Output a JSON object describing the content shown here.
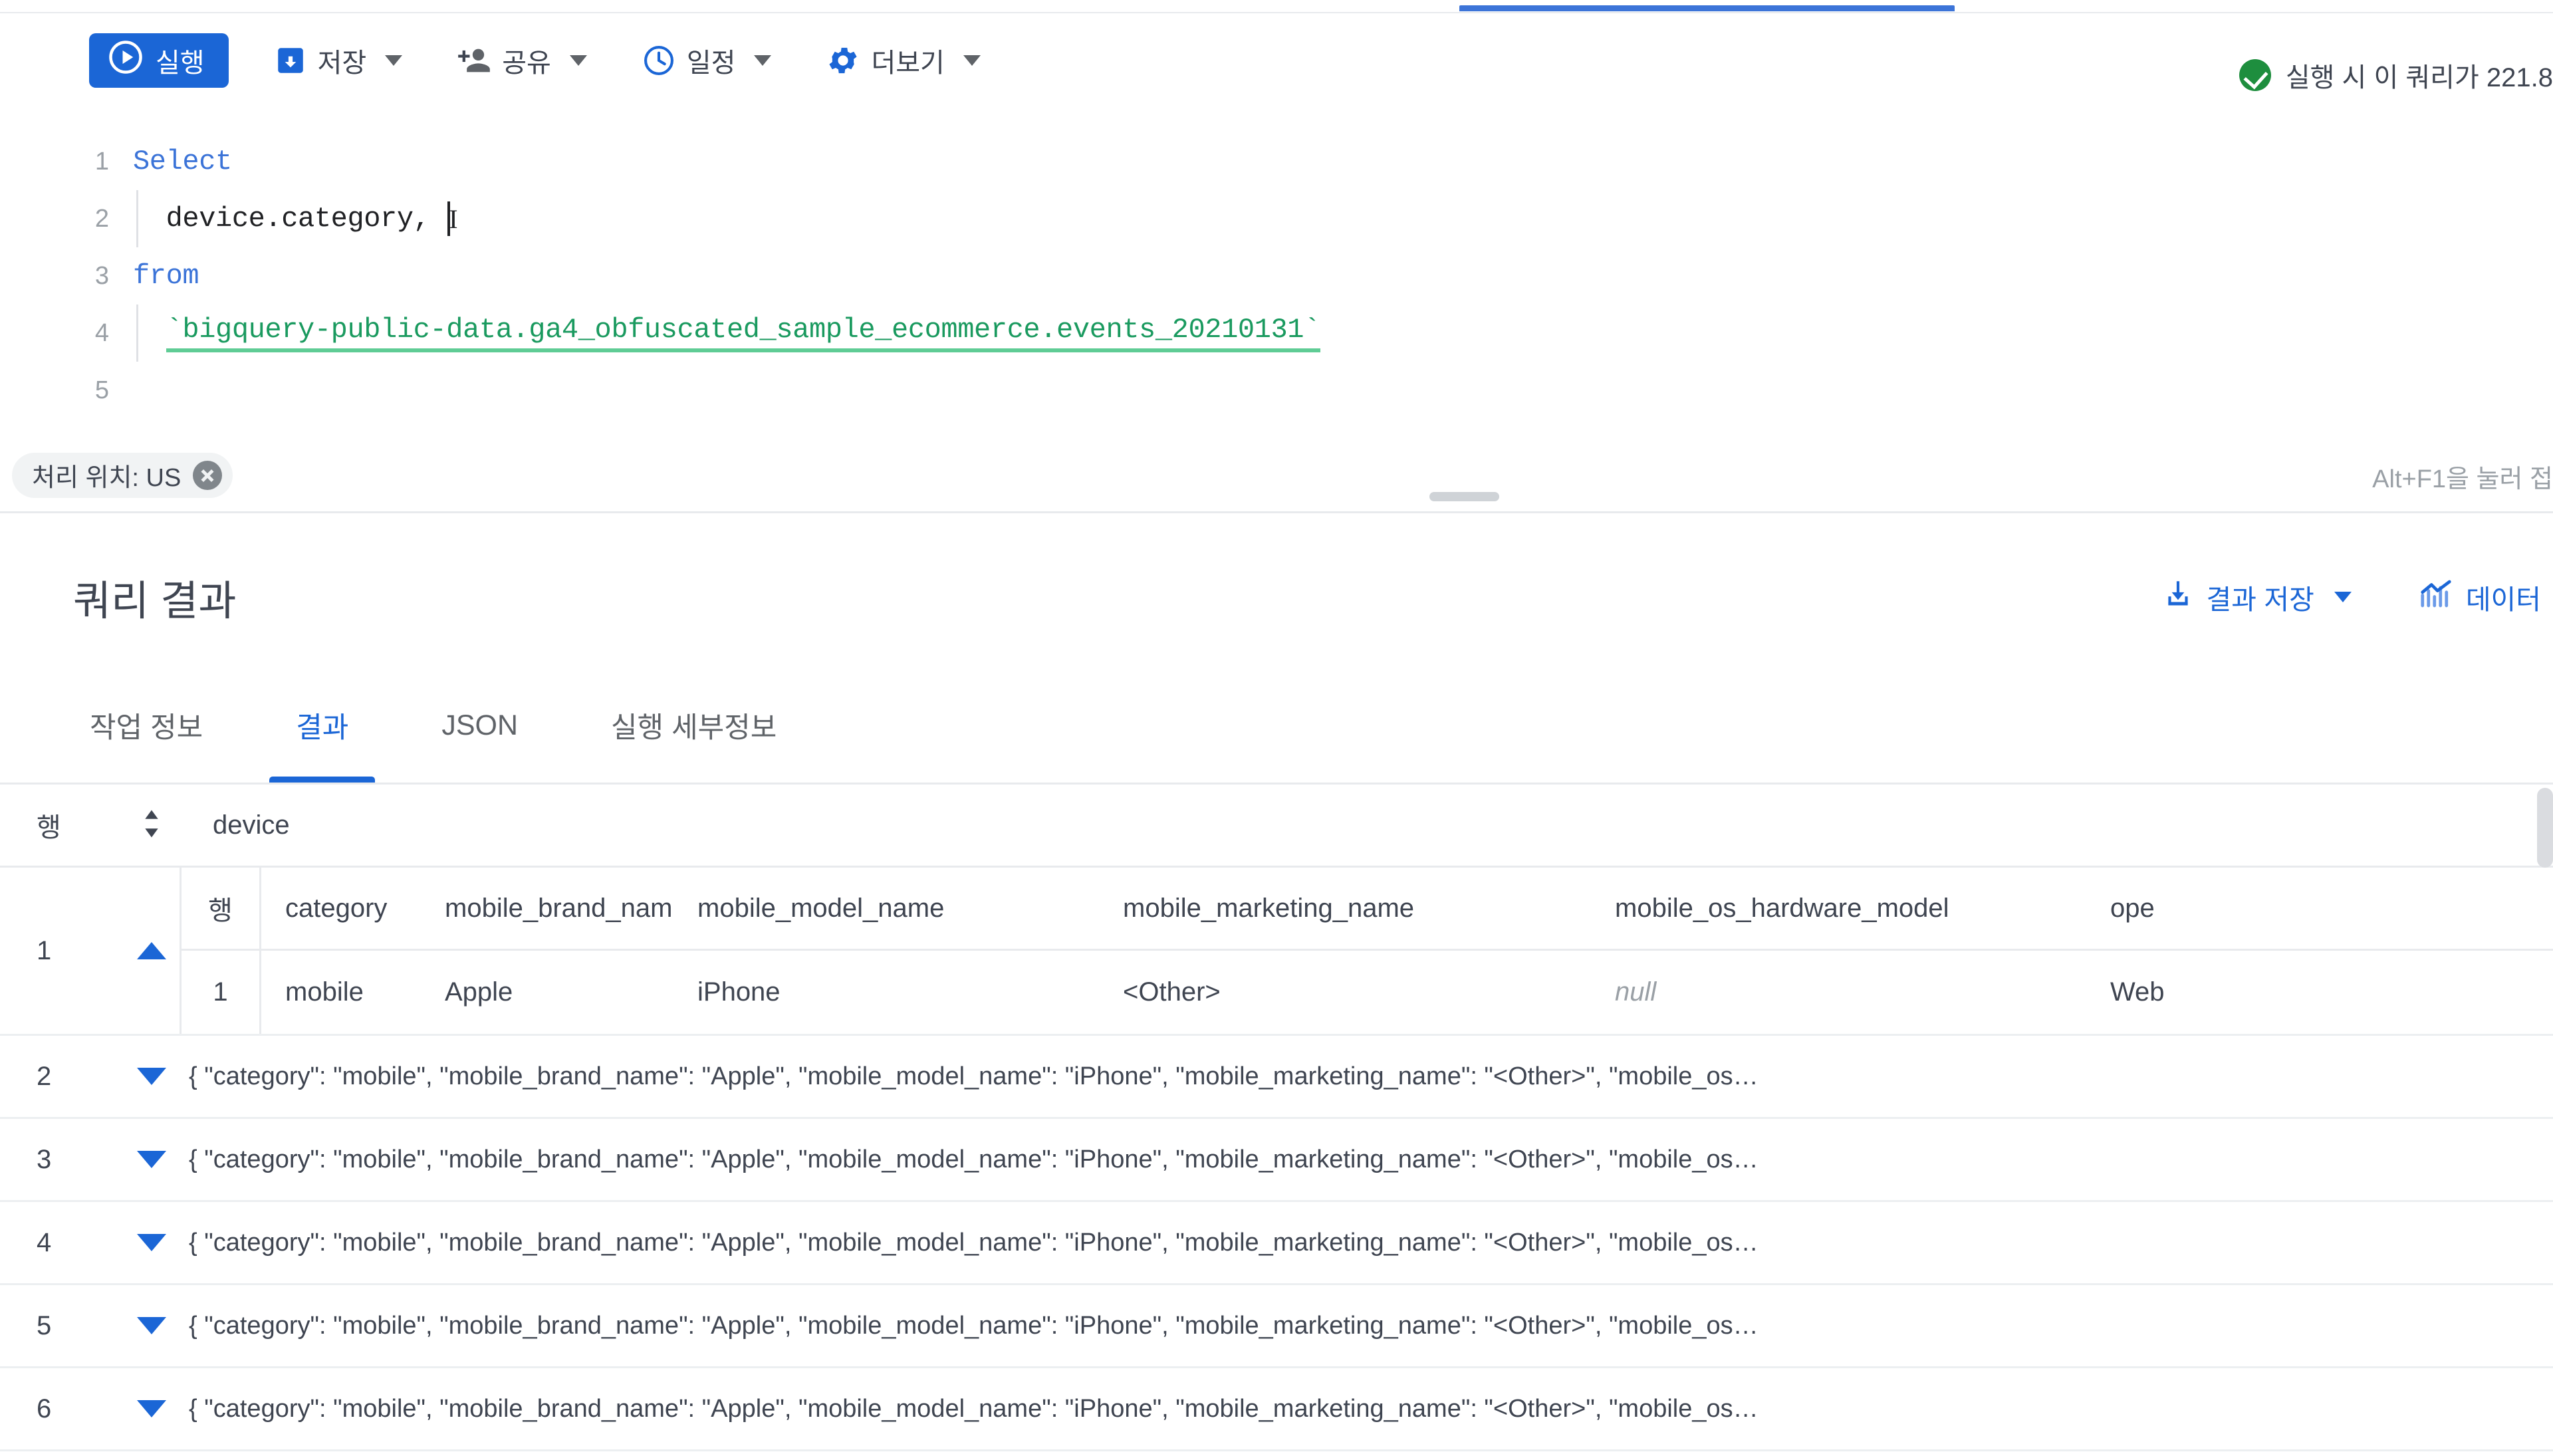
{
  "toolbar": {
    "run_label": "실행",
    "save_label": "저장",
    "share_label": "공유",
    "schedule_label": "일정",
    "more_label": "더보기",
    "validator_text": "실행 시 이 쿼리가 221.8",
    "accent_blue": "#1b66d6",
    "success_green": "#1e8e3e"
  },
  "editor": {
    "lines": [
      {
        "num": "1",
        "keyword": "Select",
        "body": "",
        "table": ""
      },
      {
        "num": "2",
        "keyword": "",
        "body": "  device.category, ",
        "table": ""
      },
      {
        "num": "3",
        "keyword": "from",
        "body": "",
        "table": ""
      },
      {
        "num": "4",
        "keyword": "",
        "body": "  ",
        "table": "`bigquery-public-data.ga4_obfuscated_sample_ecommerce.events_20210131`"
      },
      {
        "num": "5",
        "keyword": "",
        "body": "",
        "table": ""
      }
    ]
  },
  "location_bar": {
    "chip_label": "처리 위치: US",
    "hint": "Alt+F1을 눌러 접"
  },
  "results": {
    "title": "쿼리 결과",
    "save_results_label": "결과 저장",
    "explore_data_label": "데이터",
    "tabs": [
      {
        "label": "작업 정보",
        "active": false
      },
      {
        "label": "결과",
        "active": true
      },
      {
        "label": "JSON",
        "active": false
      },
      {
        "label": "실행 세부정보",
        "active": false
      }
    ]
  },
  "table": {
    "row_header_label": "행",
    "device_header_label": "device",
    "nested_headers": [
      "행",
      "category",
      "mobile_brand_name",
      "mobile_model_name",
      "mobile_marketing_name",
      "mobile_os_hardware_model",
      "ope"
    ],
    "expanded_row": {
      "num": "1",
      "nested_row_num": "1",
      "category": "mobile",
      "mobile_brand_name": "Apple",
      "mobile_model_name": "iPhone",
      "mobile_marketing_name": "<Other>",
      "mobile_os_hardware_model": "null",
      "operating_system": "Web"
    },
    "collapsed_rows": [
      {
        "num": "2",
        "json": "{ \"category\": \"mobile\", \"mobile_brand_name\": \"Apple\", \"mobile_model_name\": \"iPhone\", \"mobile_marketing_name\": \"<Other>\", \"mobile_os…"
      },
      {
        "num": "3",
        "json": "{ \"category\": \"mobile\", \"mobile_brand_name\": \"Apple\", \"mobile_model_name\": \"iPhone\", \"mobile_marketing_name\": \"<Other>\", \"mobile_os…"
      },
      {
        "num": "4",
        "json": "{ \"category\": \"mobile\", \"mobile_brand_name\": \"Apple\", \"mobile_model_name\": \"iPhone\", \"mobile_marketing_name\": \"<Other>\", \"mobile_os…"
      },
      {
        "num": "5",
        "json": "{ \"category\": \"mobile\", \"mobile_brand_name\": \"Apple\", \"mobile_model_name\": \"iPhone\", \"mobile_marketing_name\": \"<Other>\", \"mobile_os…"
      },
      {
        "num": "6",
        "json": "{ \"category\": \"mobile\", \"mobile_brand_name\": \"Apple\", \"mobile_model_name\": \"iPhone\", \"mobile_marketing_name\": \"<Other>\", \"mobile_os…"
      }
    ]
  }
}
